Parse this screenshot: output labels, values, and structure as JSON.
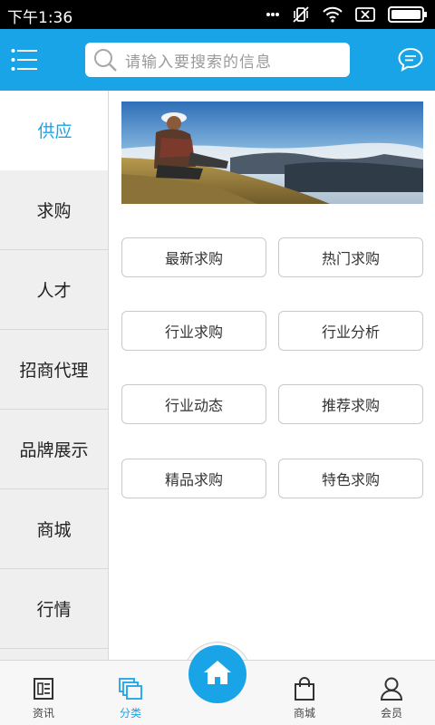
{
  "status_bar": {
    "time": "下午1:36"
  },
  "search": {
    "placeholder": "请输入要搜索的信息"
  },
  "sidebar": {
    "items": [
      {
        "label": "供应",
        "active": true
      },
      {
        "label": "求购"
      },
      {
        "label": "人才"
      },
      {
        "label": "招商代理"
      },
      {
        "label": "品牌展示"
      },
      {
        "label": "商城"
      },
      {
        "label": "行情"
      }
    ]
  },
  "grid": {
    "buttons": [
      "最新求购",
      "热门求购",
      "行业求购",
      "行业分析",
      "行业动态",
      "推荐求购",
      "精品求购",
      "特色求购"
    ]
  },
  "bottom_nav": {
    "items": [
      {
        "label": "资讯",
        "icon": "news-icon"
      },
      {
        "label": "分类",
        "icon": "category-icon",
        "active": true
      },
      {
        "label": "",
        "icon": "home-icon"
      },
      {
        "label": "商城",
        "icon": "shopping-bag-icon"
      },
      {
        "label": "会员",
        "icon": "user-icon"
      }
    ]
  },
  "colors": {
    "accent": "#1aa4e8",
    "sidebar_bg": "#efefef",
    "status_bar": "#000000"
  }
}
